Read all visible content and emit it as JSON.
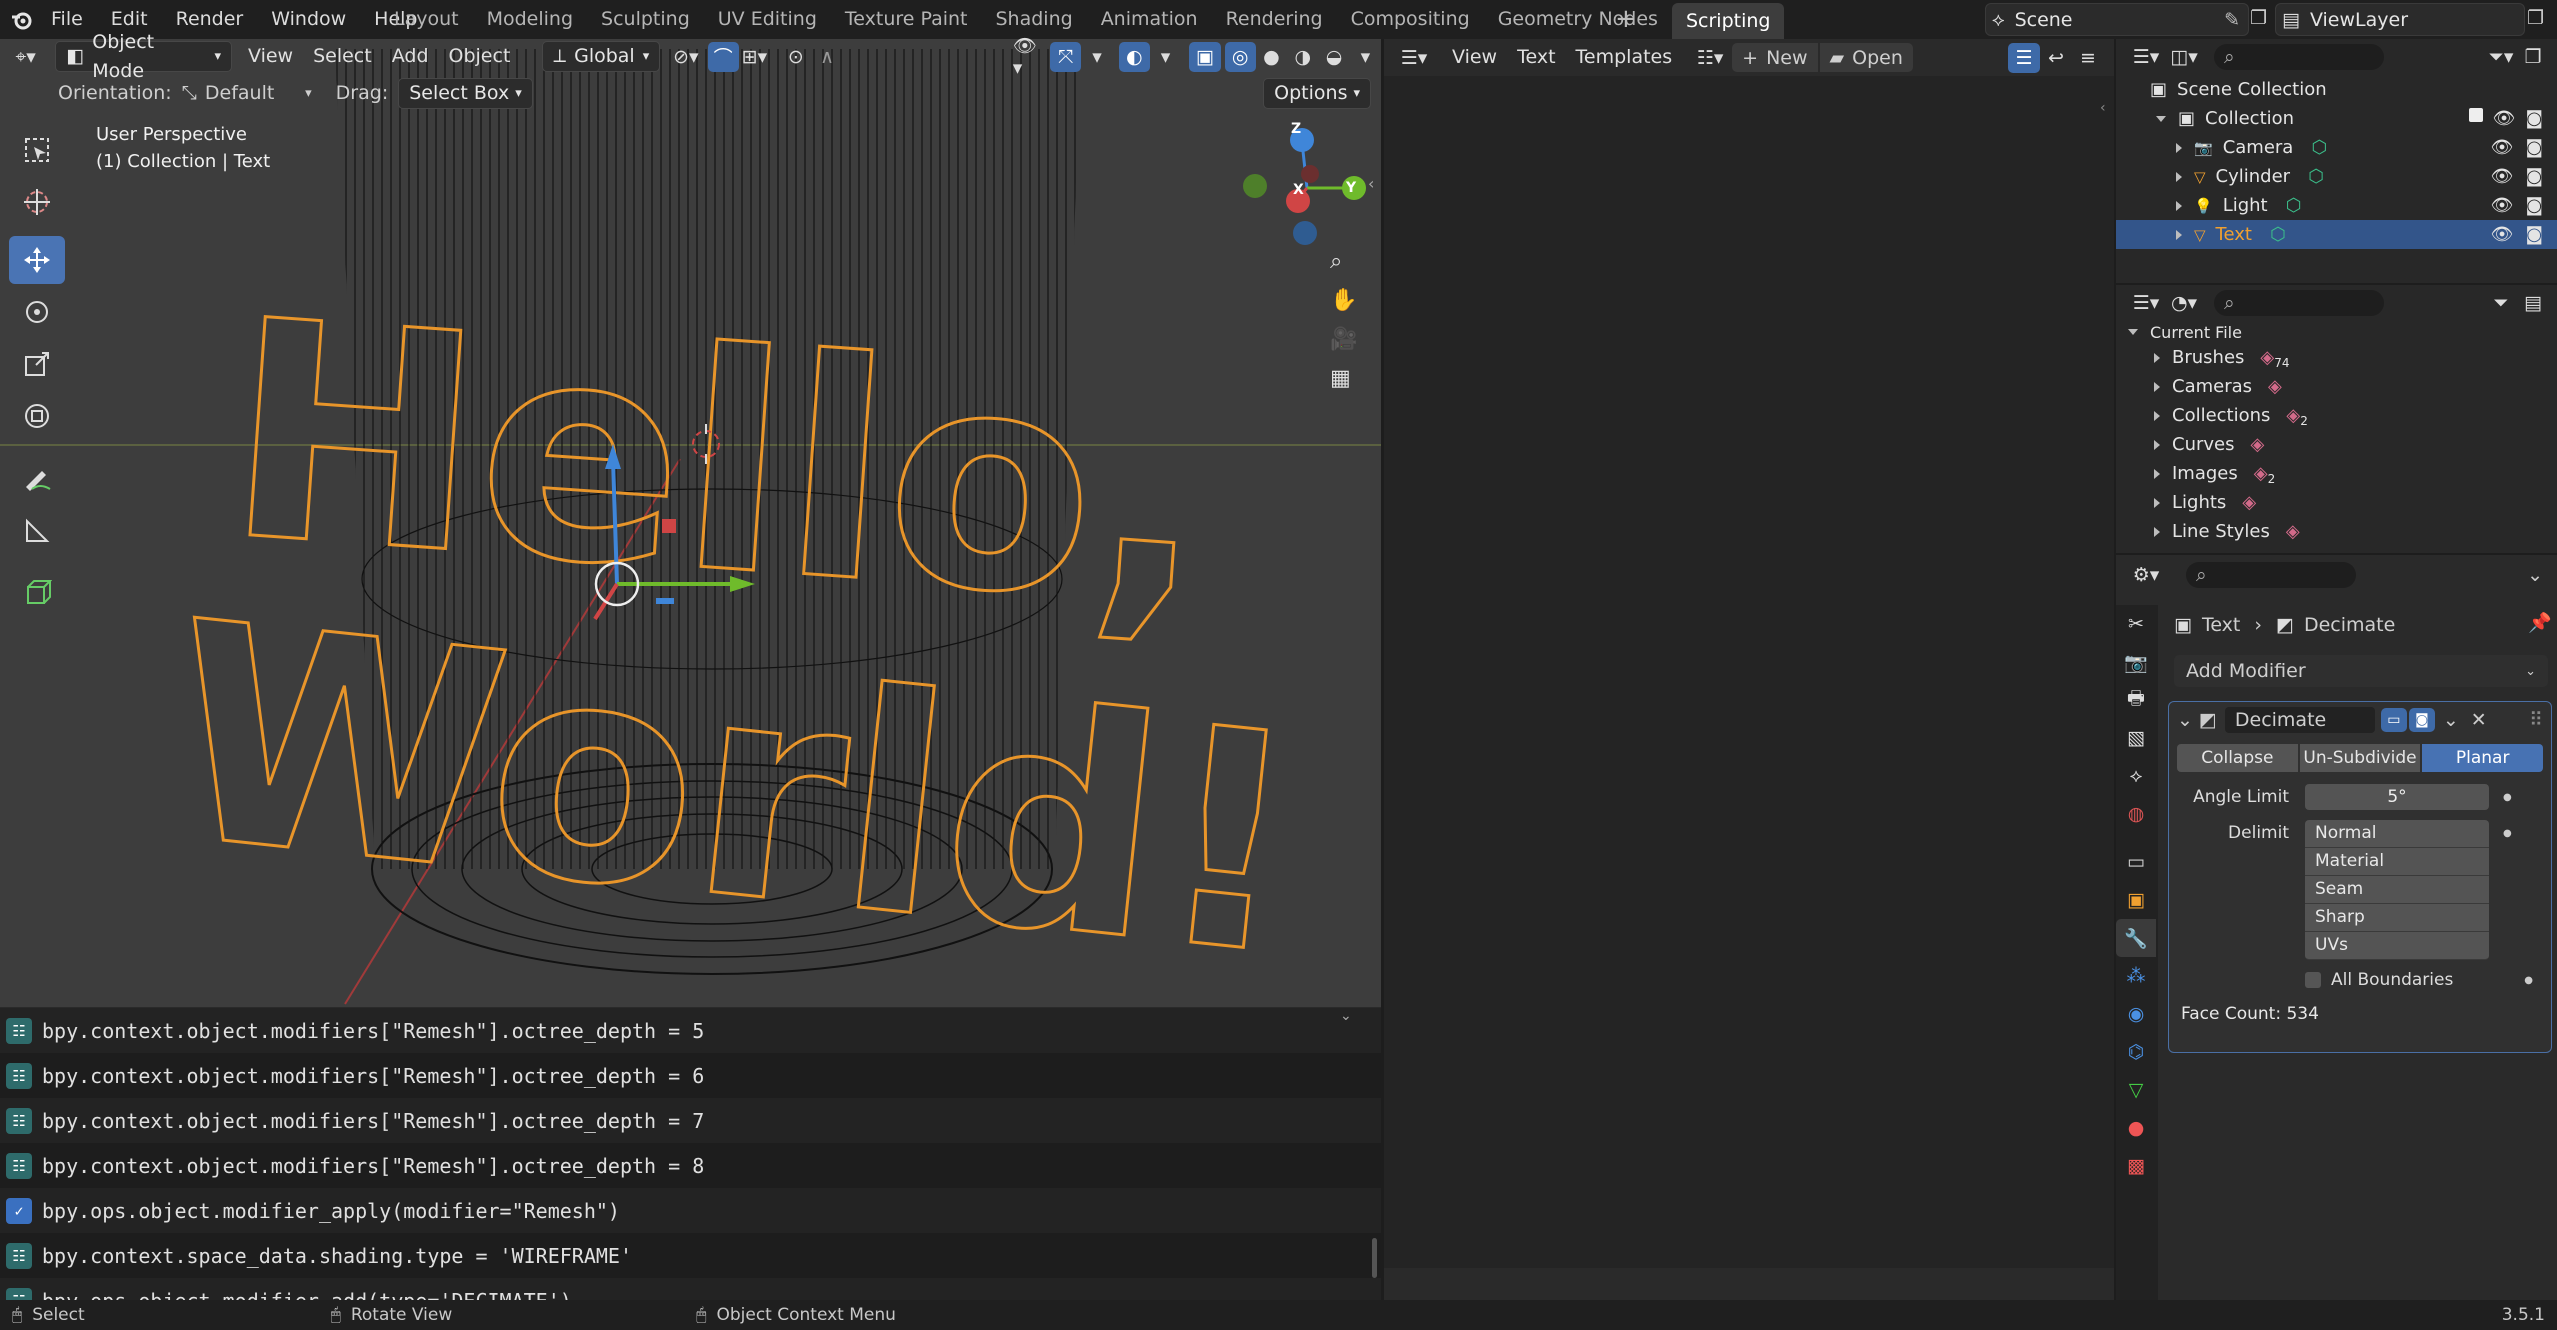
{
  "top_menu": [
    "File",
    "Edit",
    "Render",
    "Window",
    "Help"
  ],
  "workspaces": [
    "Layout",
    "Modeling",
    "Sculpting",
    "UV Editing",
    "Texture Paint",
    "Shading",
    "Animation",
    "Rendering",
    "Compositing",
    "Geometry Nodes",
    "Scripting"
  ],
  "active_workspace": "Scripting",
  "scene_name": "Scene",
  "view_layer": "ViewLayer",
  "viewport": {
    "mode": "Object Mode",
    "menus": [
      "View",
      "Select",
      "Add",
      "Object"
    ],
    "transform_orientation": "Global",
    "orientation_label": "Orientation:",
    "orientation_value": "Default",
    "drag_label": "Drag:",
    "drag_value": "Select Box",
    "options_label": "Options",
    "overlay_title": "User Perspective",
    "overlay_subtitle": "(1) Collection | Text",
    "gizmo_axes": {
      "z": "Z",
      "x": "X",
      "y": "Y"
    },
    "colors": {
      "wire_text": "#e8952a",
      "wire_cylinder": "#0a0a0a",
      "background": "#3d3d3d"
    }
  },
  "console": {
    "lines": [
      {
        "kind": "info",
        "text": "bpy.context.object.modifiers[\"Remesh\"].octree_depth = 5"
      },
      {
        "kind": "info",
        "text": "bpy.context.object.modifiers[\"Remesh\"].octree_depth = 6"
      },
      {
        "kind": "info",
        "text": "bpy.context.object.modifiers[\"Remesh\"].octree_depth = 7"
      },
      {
        "kind": "info",
        "text": "bpy.context.object.modifiers[\"Remesh\"].octree_depth = 8"
      },
      {
        "kind": "op",
        "text": "bpy.ops.object.modifier_apply(modifier=\"Remesh\")"
      },
      {
        "kind": "info",
        "text": "bpy.context.space_data.shading.type = 'WIREFRAME'"
      },
      {
        "kind": "info",
        "text": "bpy.ops.object.modifier_add(type='DECIMATE')"
      }
    ]
  },
  "text_editor": {
    "menus": [
      "View",
      "Text",
      "Templates"
    ],
    "new_label": "New",
    "open_label": "Open"
  },
  "outliner": {
    "scene_collection": "Scene Collection",
    "collection": "Collection",
    "items": [
      {
        "name": "Camera",
        "icon": "camera-icon",
        "selected": false
      },
      {
        "name": "Cylinder",
        "icon": "mesh-icon",
        "selected": false
      },
      {
        "name": "Light",
        "icon": "light-icon",
        "selected": false
      },
      {
        "name": "Text",
        "icon": "text-object-icon",
        "selected": true
      }
    ]
  },
  "data_browser": {
    "root": "Current File",
    "items": [
      {
        "name": "Brushes",
        "count": "74"
      },
      {
        "name": "Cameras",
        "count": ""
      },
      {
        "name": "Collections",
        "count": "2"
      },
      {
        "name": "Curves",
        "count": ""
      },
      {
        "name": "Images",
        "count": "2"
      },
      {
        "name": "Lights",
        "count": ""
      },
      {
        "name": "Line Styles",
        "count": ""
      }
    ]
  },
  "properties": {
    "breadcrumb_object": "Text",
    "breadcrumb_modifier": "Decimate",
    "add_modifier_label": "Add Modifier",
    "modifier_name": "Decimate",
    "mode_tabs": [
      "Collapse",
      "Un-Subdivide",
      "Planar"
    ],
    "active_mode": "Planar",
    "angle_limit_label": "Angle Limit",
    "angle_limit_value": "5°",
    "delimit_label": "Delimit",
    "delimit_options": [
      "Normal",
      "Material",
      "Seam",
      "Sharp",
      "UVs"
    ],
    "all_boundaries_label": "All Boundaries",
    "face_count": "Face Count: 534"
  },
  "statusbar": {
    "select": "Select",
    "rotate": "Rotate View",
    "context_menu": "Object Context Menu",
    "version": "3.5.1"
  }
}
